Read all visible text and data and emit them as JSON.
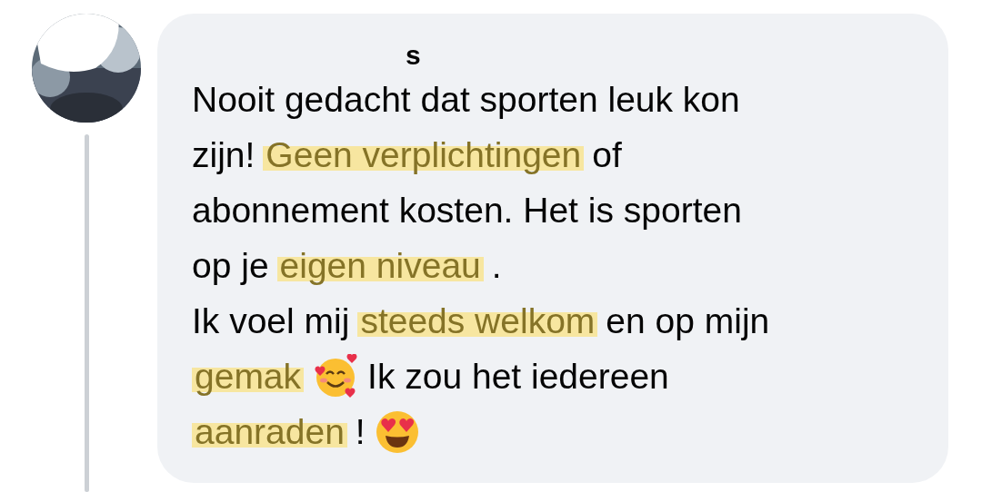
{
  "comment": {
    "author": "s",
    "lines": [
      [
        {
          "kind": "text",
          "text": "Nooit gedacht dat sporten leuk kon",
          "highlighted": false
        }
      ],
      [
        {
          "kind": "text",
          "text": "zijn!",
          "highlighted": false
        },
        {
          "kind": "text",
          "text": "Geen verplichtingen",
          "highlighted": true
        },
        {
          "kind": "text",
          "text": "of",
          "highlighted": false
        }
      ],
      [
        {
          "kind": "text",
          "text": "abonnement kosten. Het is sporten",
          "highlighted": false
        }
      ],
      [
        {
          "kind": "text",
          "text": "op je",
          "highlighted": false
        },
        {
          "kind": "text",
          "text": "eigen niveau",
          "highlighted": true
        },
        {
          "kind": "text",
          "text": ".",
          "highlighted": false
        }
      ],
      [
        {
          "kind": "text",
          "text": "Ik voel mij",
          "highlighted": false
        },
        {
          "kind": "text",
          "text": "steeds welkom",
          "highlighted": true
        },
        {
          "kind": "text",
          "text": "en op mijn",
          "highlighted": false
        }
      ],
      [
        {
          "kind": "text",
          "text": "gemak",
          "highlighted": true
        },
        {
          "kind": "smile"
        },
        {
          "kind": "text",
          "text": "Ik zou het iedereen",
          "highlighted": false
        }
      ],
      [
        {
          "kind": "text",
          "text": "aanraden",
          "highlighted": true
        },
        {
          "kind": "text",
          "text": "!",
          "highlighted": false
        },
        {
          "kind": "hearteyes"
        }
      ]
    ]
  }
}
